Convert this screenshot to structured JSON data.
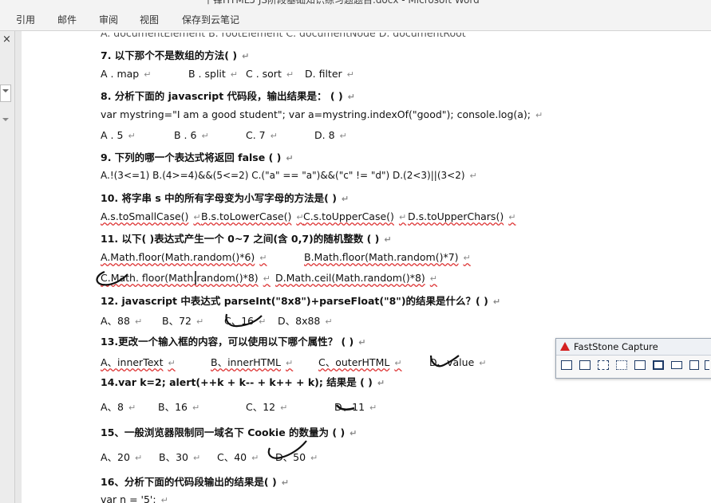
{
  "window": {
    "title_partial": "千锋HTML5 JS阶段基础知识练习题题目.docx - Microsoft Word"
  },
  "ribbon": {
    "tabs": [
      "引用",
      "邮件",
      "审阅",
      "视图",
      "保存到云笔记"
    ]
  },
  "sidebar": {
    "close_glyph": "×"
  },
  "document": {
    "cutoff_line": "A. documentElement   B. rootElement   C. documentNode   D. documentRoot",
    "questions": [
      {
        "id": "q7",
        "text": "7.    以下那个不是数组的方法(           )",
        "options": [
          "A .   map",
          "B . split",
          "C . sort",
          "D. filter"
        ]
      },
      {
        "id": "q8",
        "text": "8.    分析下面的 javascript 代码段，输出结果是：  (               )",
        "code": "var mystring=\"I am a good student\";   var a=mystring.indexOf(\"good\"); console.log(a);",
        "options": [
          "A .  5",
          "B .    6",
          "C.    7",
          "D.    8"
        ]
      },
      {
        "id": "q9",
        "text": "9.    下列的哪一个表达式将返回 false (               )",
        "options": [
          "A.!(3<=1)   B.(4>=4)&&(5<=2)   C.(\"a\" == \"a\")&&(\"c\" != \"d\")   D.(2<3)||(3<2)"
        ]
      },
      {
        "id": "q10",
        "text": "10.    将字串 s 中的所有字母变为小写字母的方法是(           )",
        "options": [
          "A.s.toSmallCase()",
          "B.s.toLowerCase()",
          "C.s.toUpperCase()",
          "D.s.toUpperChars()"
        ]
      },
      {
        "id": "q11",
        "text": "11.    以下( )表达式产生一个 0~7 之间(含 0,7)的随机整数  (               )",
        "options": [
          "A.Math.floor(Math.random()*6)",
          "B.Math.floor(Math.random()*7)",
          "C.Math. floor(Math.random()*8)",
          "D.Math.ceil(Math.random()*8)"
        ]
      },
      {
        "id": "q12",
        "text": "12.    javascript 中表达式 parseInt(\"8x8\")+parseFloat(\"8\")的结果是什么？(          )",
        "options": [
          "A、88",
          "B、72",
          "C、16",
          "D、8x88"
        ]
      },
      {
        "id": "q13",
        "text": "13.更改一个输入框的内容，可以使用以下哪个属性？  (               )",
        "options": [
          "A、innerText",
          "B、innerHTML",
          "C、outerHTML",
          "D、value"
        ]
      },
      {
        "id": "q14",
        "text": "14.var k=2;   alert(++k + k-- + k++ + k);  结果是  (               )",
        "options": [
          "A、8",
          "B、16",
          "C、12",
          "D、11"
        ]
      },
      {
        "id": "q15",
        "text": "15、一般浏览器限制同一域名下 Cookie 的数量为  (               )",
        "options": [
          "A、20",
          "B、30",
          "C、40",
          "D、50"
        ]
      },
      {
        "id": "q16",
        "text": "16、分析下面的代码段输出的结果是(             )",
        "code": "var n = '5';"
      }
    ],
    "paragraph_mark": "↵"
  },
  "faststone": {
    "title": "FastStone Capture",
    "tools": [
      "capture-active-window-icon",
      "capture-window-object-icon",
      "capture-rectangle-icon",
      "capture-freehand-icon",
      "capture-fullscreen-icon",
      "capture-scrolling-icon",
      "capture-fixed-region-icon",
      "screen-recorder-icon",
      "video-capture-icon",
      "draw-icon"
    ]
  }
}
